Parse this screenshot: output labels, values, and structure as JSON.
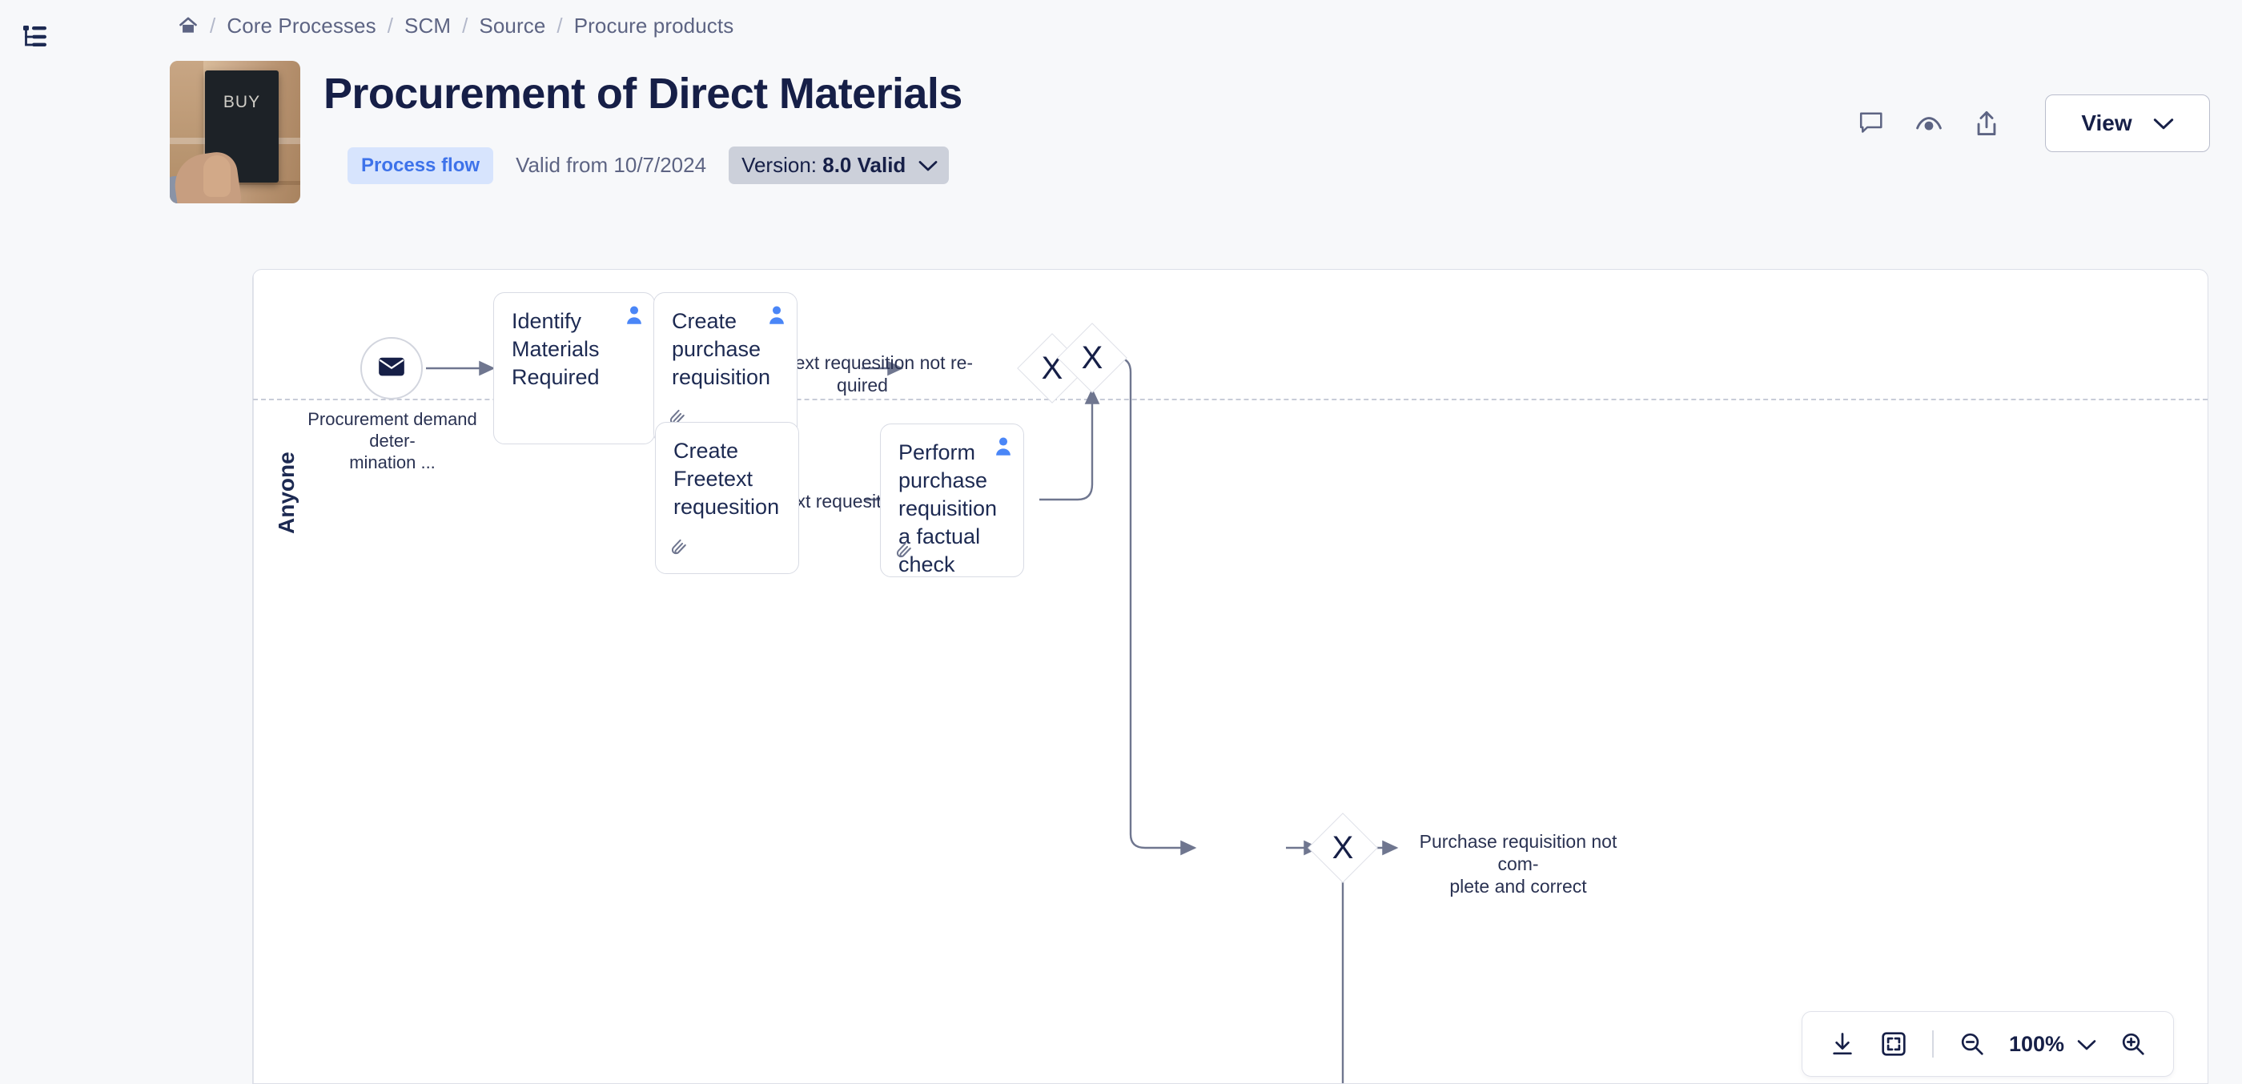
{
  "topbar": {
    "tree_icon": "tree-list-icon",
    "breadcrumb": {
      "home_icon": "home-icon",
      "separator": "/",
      "items": [
        {
          "label": "Core Processes"
        },
        {
          "label": "SCM"
        },
        {
          "label": "Source"
        },
        {
          "label": "Procure products"
        }
      ]
    }
  },
  "header": {
    "thumbnail_alt": "BUY card held in hand",
    "thumbnail_text": "BUY",
    "title": "Procurement of Direct Materials",
    "type_badge": "Process flow",
    "valid_from": "Valid from 10/7/2024",
    "version_prefix": "Version: ",
    "version_value": "8.0 Valid",
    "version_chevron": "chevron-down-icon",
    "actions": [
      {
        "name": "comment-icon",
        "title": "Comments"
      },
      {
        "name": "watch-eye-icon",
        "title": "Watch"
      },
      {
        "name": "share-icon",
        "title": "Share"
      }
    ],
    "view_button": "View",
    "view_chevron": "chevron-down-icon"
  },
  "diagram": {
    "lane": "Anyone",
    "start_event": {
      "icon": "envelope-icon",
      "label": "Procurement demand deter-\nmination ..."
    },
    "tasks": [
      {
        "id": "identify",
        "title": "Identify Materials Required",
        "person_icon": "person-icon",
        "has_attachment": false
      },
      {
        "id": "create_pr",
        "title": "Create purchase requisition",
        "person_icon": "person-icon",
        "has_attachment": true,
        "attachment_icon": "paperclip-icon"
      },
      {
        "id": "create_freetext",
        "title": "Create Freetext requesition",
        "person_icon": "person-icon",
        "has_attachment": true,
        "attachment_icon": "paperclip-icon"
      },
      {
        "id": "factual_check",
        "title": "Perform purchase requisition a factual check",
        "person_icon": "person-icon",
        "has_attachment": true,
        "attachment_icon": "paperclip-icon"
      }
    ],
    "gateways": [
      {
        "id": "gw_split",
        "symbol": "X",
        "type": "exclusive"
      },
      {
        "id": "gw_merge",
        "symbol": "X",
        "type": "exclusive"
      },
      {
        "id": "gw_check",
        "symbol": "X",
        "type": "exclusive"
      }
    ],
    "edge_labels": [
      {
        "id": "lbl_not_required",
        "text": "Freetext requesition not re-\nquired"
      },
      {
        "id": "lbl_required",
        "text": "Freetext requesition required"
      },
      {
        "id": "lbl_not_complete",
        "text": "Purchase requisition not com-\nplete and correct"
      }
    ]
  },
  "zoom_toolbar": {
    "download_icon": "download-icon",
    "fit_icon": "fit-to-screen-icon",
    "zoom_out_icon": "zoom-out-icon",
    "zoom_level": "100%",
    "zoom_chevron": "chevron-down-icon",
    "zoom_in_icon": "zoom-in-icon"
  },
  "colors": {
    "page_bg": "#f7f8fa",
    "canvas_bg": "#ffffff",
    "title": "#161f47",
    "muted": "#5d6483",
    "accent_blue": "#3d72ea",
    "badge_bg": "#d7e4fd",
    "chip_bg": "#ccd0da",
    "edge": "#6f768f",
    "node_border": "#d8dbe4"
  }
}
